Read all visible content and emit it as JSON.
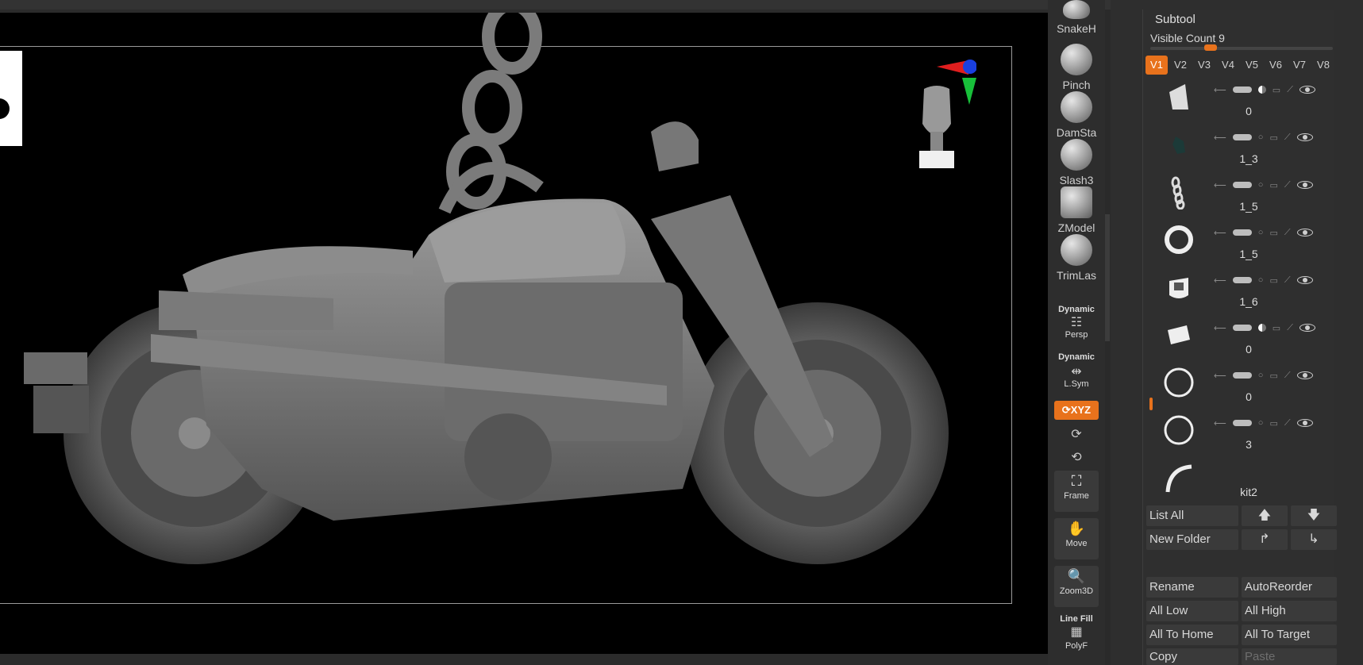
{
  "toolbar": {
    "brushes": [
      {
        "label": "SnakeH",
        "icon": "snake-hook-brush-icon"
      },
      {
        "label": "Pinch",
        "icon": "pinch-brush-icon"
      },
      {
        "label": "DamSta",
        "icon": "damstandard-brush-icon"
      },
      {
        "label": "Slash3",
        "icon": "slash3-brush-icon"
      },
      {
        "label": "ZModel",
        "icon": "zmodeler-brush-icon"
      },
      {
        "label": "TrimLas",
        "icon": "trim-lasso-brush-icon"
      }
    ],
    "persp_top": "Dynamic",
    "persp_label": "Persp",
    "lsym_top": "Dynamic",
    "lsym_label": "L.Sym",
    "xyz_label": "XYZ",
    "frame_label": "Frame",
    "move_label": "Move",
    "zoom_label": "Zoom3D",
    "polyf_top": "Line Fill",
    "polyf_label": "PolyF"
  },
  "subtool": {
    "title": "Subtool",
    "visible_count": "Visible Count 9",
    "visible_count_value": 9,
    "tabs": [
      "V1",
      "V2",
      "V3",
      "V4",
      "V5",
      "V6",
      "V7",
      "V8"
    ],
    "active_tab": "V1",
    "rows": [
      {
        "name": "0",
        "shape": "cylinder"
      },
      {
        "name": "1_3",
        "shape": "gem"
      },
      {
        "name": "1_5",
        "shape": "chain"
      },
      {
        "name": "1_5",
        "shape": "ring"
      },
      {
        "name": "1_6",
        "shape": "clip"
      },
      {
        "name": "0",
        "shape": "block"
      },
      {
        "name": "0",
        "shape": "ring-thin"
      },
      {
        "name": "3",
        "shape": "ring-thin"
      },
      {
        "name": "kit2",
        "shape": "arc"
      }
    ],
    "buttons": {
      "list_all": "List All",
      "new_folder": "New Folder",
      "rename": "Rename",
      "auto_reorder": "AutoReorder",
      "all_low": "All Low",
      "all_high": "All High",
      "all_to_home": "All To Home",
      "all_to_target": "All To Target",
      "copy": "Copy",
      "paste": "Paste"
    }
  },
  "colors": {
    "accent": "#e8721c",
    "panel_bg": "#2e2e2e",
    "viewport_bg": "#000000"
  }
}
